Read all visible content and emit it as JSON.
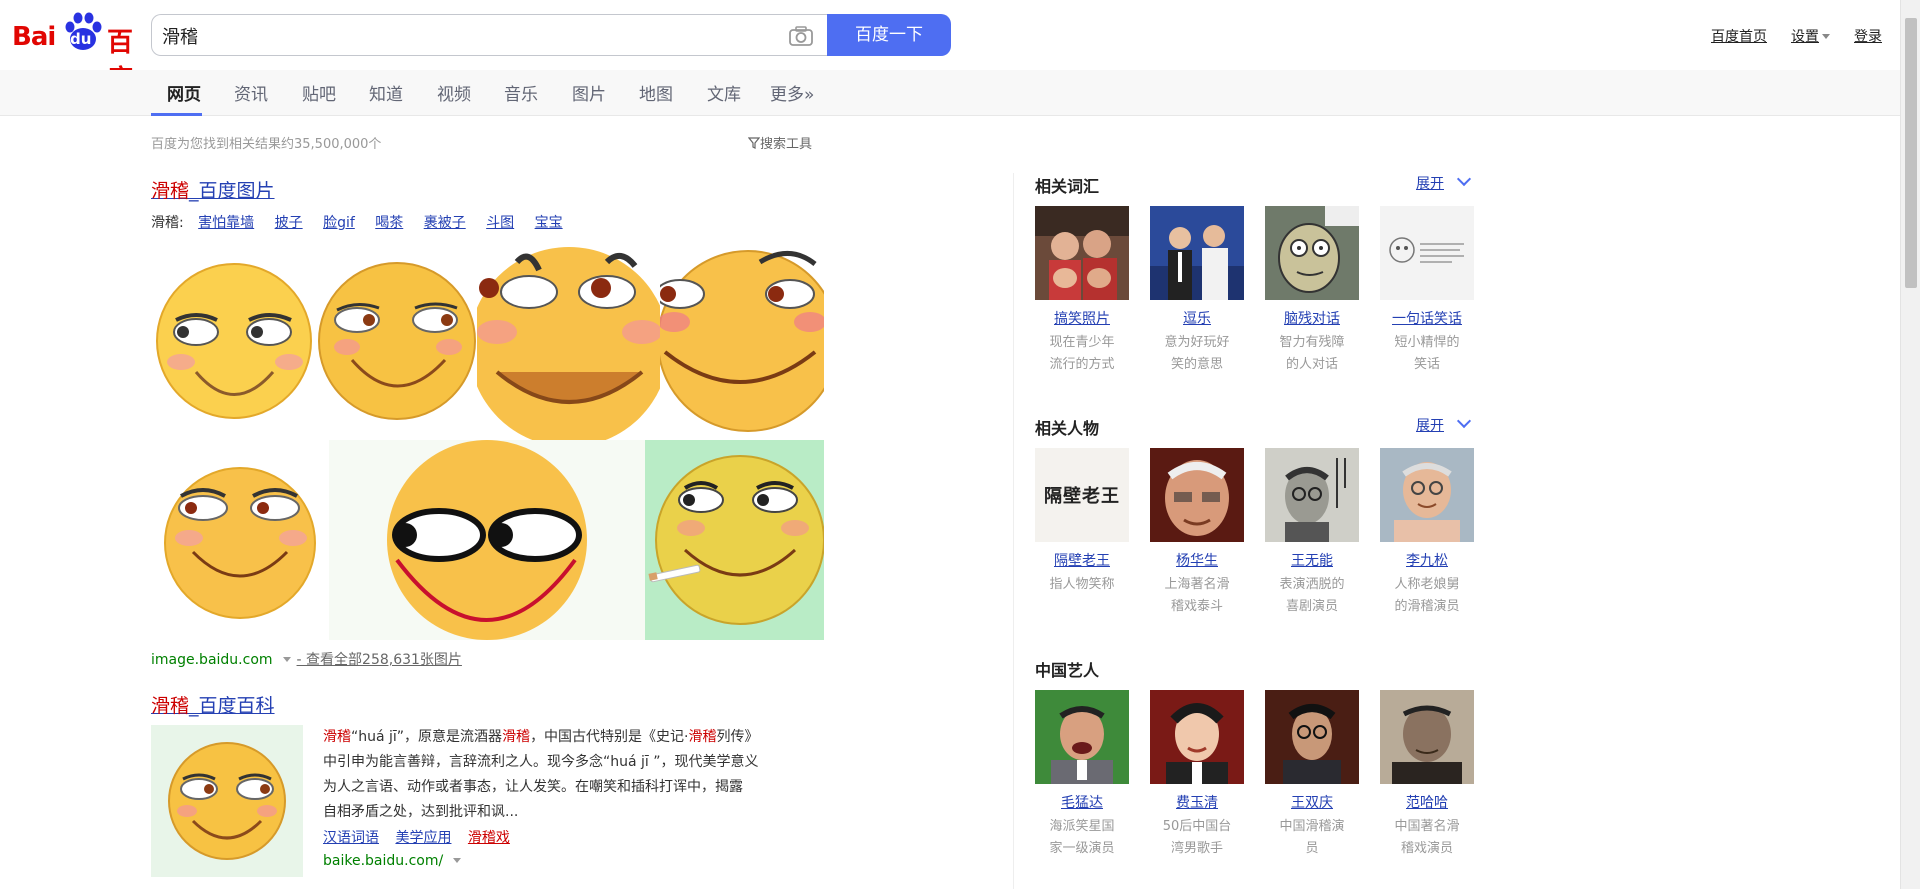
{
  "header": {
    "logo_bai": "Bai",
    "logo_du": "du",
    "logo_cn": "百度",
    "search_value": "滑稽",
    "search_button": "百度一下",
    "links": [
      "百度首页",
      "设置",
      "登录"
    ]
  },
  "tabs": [
    "网页",
    "资讯",
    "贴吧",
    "知道",
    "视频",
    "音乐",
    "图片",
    "地图",
    "文库",
    "更多»"
  ],
  "result_count": "百度为您找到相关结果约35,500,000个",
  "search_tools": "搜索工具",
  "image_result": {
    "title_hl": "滑稽",
    "title_rest": "_百度图片",
    "tag_prefix": "滑稽:",
    "tags": [
      "害怕靠墙",
      "披子",
      "脸gif",
      "喝茶",
      "裹被子",
      "斗图",
      "宝宝"
    ],
    "source": "image.baidu.com",
    "more": "- 查看全部258,631张图片"
  },
  "baike_result": {
    "title_hl": "滑稽",
    "title_rest": "_百度百科",
    "lines": [
      [
        "滑稽",
        "“huá jī”，原意是流酒器",
        "滑稽",
        "，中国古代特别是《史记·",
        "滑稽",
        "列传》"
      ],
      [
        "中引申为能言善辩，言辞流利之人。现今多念“huá jī ”，现代美学意义"
      ],
      [
        "为人之言语、动作或者事态，让人发笑。在嘲笑和插科打诨中，揭露"
      ],
      [
        "自相矛盾之处，达到批评和讽..."
      ]
    ],
    "links": [
      "汉语词语",
      "美学应用",
      "滑稽戏"
    ],
    "source": "baike.baidu.com/"
  },
  "right": {
    "expand_label": "展开",
    "sections": [
      {
        "title": "相关词汇",
        "has_expand": true,
        "cards": [
          {
            "name": "搞笑照片",
            "desc": [
              "现在青少年",
              "流行的方式"
            ]
          },
          {
            "name": "逗乐",
            "desc": [
              "意为好玩好",
              "笑的意思"
            ]
          },
          {
            "name": "脑残对话",
            "desc": [
              "智力有残障",
              "的人对话"
            ]
          },
          {
            "name": "一句话笑话",
            "desc": [
              "短小精悍的",
              "笑话"
            ]
          }
        ]
      },
      {
        "title": "相关人物",
        "has_expand": true,
        "cards": [
          {
            "name": "隔壁老王",
            "desc": [
              "指人物笑称",
              ""
            ]
          },
          {
            "name": "杨华生",
            "desc": [
              "上海著名滑",
              "稽戏泰斗"
            ]
          },
          {
            "name": "王无能",
            "desc": [
              "表演洒脱的",
              "喜剧演员"
            ]
          },
          {
            "name": "李九松",
            "desc": [
              "人称老娘舅",
              "的滑稽演员"
            ]
          }
        ]
      },
      {
        "title": "中国艺人",
        "has_expand": false,
        "cards": [
          {
            "name": "毛猛达",
            "desc": [
              "海派笑星国",
              "家一级演员"
            ]
          },
          {
            "name": "费玉清",
            "desc": [
              "50后中国台",
              "湾男歌手"
            ]
          },
          {
            "name": "王双庆",
            "desc": [
              "中国滑稽演",
              "员"
            ]
          },
          {
            "name": "范哈哈",
            "desc": [
              "中国著名滑",
              "稽戏演员"
            ]
          }
        ]
      }
    ],
    "calligraphy_text": "隔壁老王"
  },
  "colors": {
    "brand_blue": "#4e6ef2",
    "brand_red": "#e10602",
    "link": "#2440b3",
    "highlight": "#c00000",
    "source_green": "#008000"
  }
}
